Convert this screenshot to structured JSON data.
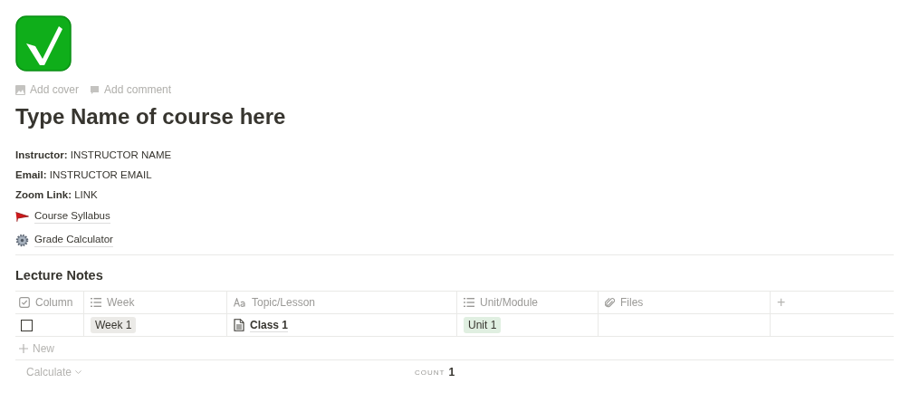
{
  "page_actions": [
    "Add cover",
    "Add comment"
  ],
  "title": "Type Name of course here",
  "properties": [
    "**Instructor:** INSTRUCTOR NAME",
    "**Email:** INSTRUCTOR EMAIL",
    "**Zoom Link:** LINK"
  ],
  "links": [
    {
      "kind": "flag",
      "label": "Course Syllabus"
    },
    {
      "kind": "gear",
      "label": "Grade Calculator"
    }
  ],
  "database": {
    "title": "Lecture Notes",
    "columns": [
      {
        "kind": "checkbox",
        "label": "Column"
      },
      {
        "kind": "list",
        "label": "Week"
      },
      {
        "kind": "title",
        "label": "Topic/Lesson"
      },
      {
        "kind": "list",
        "label": "Unit/Module"
      },
      {
        "kind": "files",
        "label": "Files"
      },
      {
        "kind": "add",
        "label": "+"
      }
    ],
    "rows": [
      {
        "checked": false,
        "week": {
          "label": "Week 1",
          "color": "#ebeae7"
        },
        "topic": "Class 1",
        "unit": {
          "label": "Unit 1",
          "color": "#e0efe1"
        }
      }
    ],
    "new_label": "New",
    "calculate": "Calculate",
    "count_label": "COUNT",
    "count": "1"
  }
}
